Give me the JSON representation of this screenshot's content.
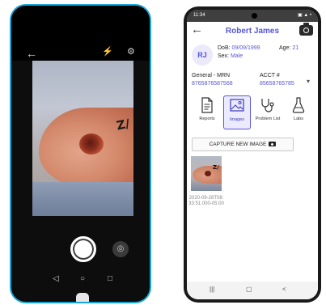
{
  "camera_app": {
    "icons": {
      "back": "arrow-left-icon",
      "flash": "flash-off-icon",
      "settings": "gear-icon",
      "shutter": "shutter-button",
      "gallery": "gallery-icon"
    },
    "photo_mark": "Z/"
  },
  "patient_app": {
    "status_time": "11:34",
    "status_icons": "▣ ▲ •",
    "header": {
      "title": "Robert James"
    },
    "patient": {
      "initials": "RJ",
      "dob_label": "DoB:",
      "dob": "09/09/1999",
      "age_label": "Age:",
      "age": "21",
      "sex_label": "Sex:",
      "sex": "Male"
    },
    "ids": {
      "mrn_label": "General - MRN",
      "mrn": "8765876587568",
      "acct_label": "ACCT #",
      "acct": "85658765785"
    },
    "tabs": [
      {
        "label": "Reports",
        "active": false
      },
      {
        "label": "Images",
        "active": true
      },
      {
        "label": "Problem List",
        "active": false
      },
      {
        "label": "Labs",
        "active": false
      }
    ],
    "capture_label": "CAPTURE NEW IMAGE",
    "images": [
      {
        "mark": "Z/",
        "timestamp": "2020-09-28T08:33:51.000-05:00"
      }
    ],
    "accent_color": "#5656d6"
  }
}
